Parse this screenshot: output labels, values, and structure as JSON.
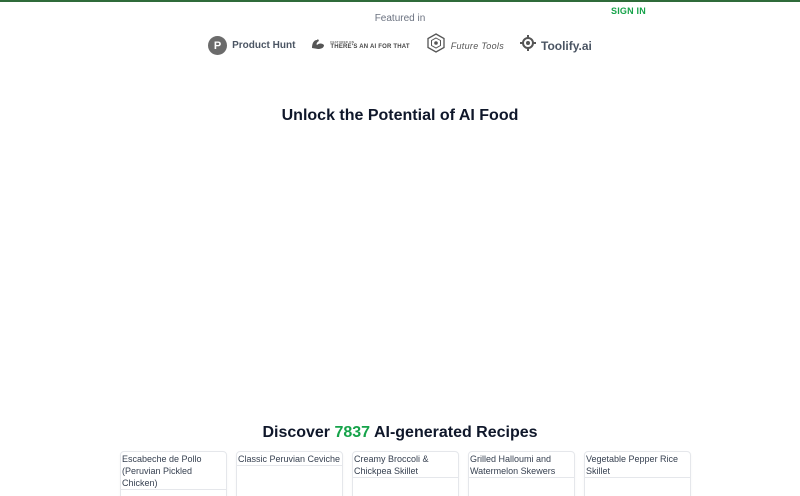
{
  "header": {
    "signin_label": "SIGN IN"
  },
  "featured": {
    "label": "Featured in",
    "logos": [
      {
        "name": "Product Hunt",
        "mark": "P"
      },
      {
        "name": "THERE'S AN AI FOR THAT",
        "prefix": "FEATURED ON"
      },
      {
        "name": "Future Tools"
      },
      {
        "name": "Toolify.ai"
      }
    ]
  },
  "hero": {
    "title": "Unlock the Potential of AI Food"
  },
  "discover": {
    "prefix": "Discover",
    "count": "7837",
    "suffix": "AI-generated Recipes"
  },
  "recipes": [
    {
      "alt": "Escabeche de Pollo (Peruvian Pickled Chicken)"
    },
    {
      "alt": "Classic Peruvian Ceviche"
    },
    {
      "alt": "Creamy Broccoli & Chickpea Skillet"
    },
    {
      "alt": "Grilled Halloumi and Watermelon Skewers"
    },
    {
      "alt": "Vegetable Pepper Rice Skillet"
    }
  ],
  "colors": {
    "accent": "#16a34a",
    "heading": "#0f172a",
    "muted": "#6b7280"
  }
}
